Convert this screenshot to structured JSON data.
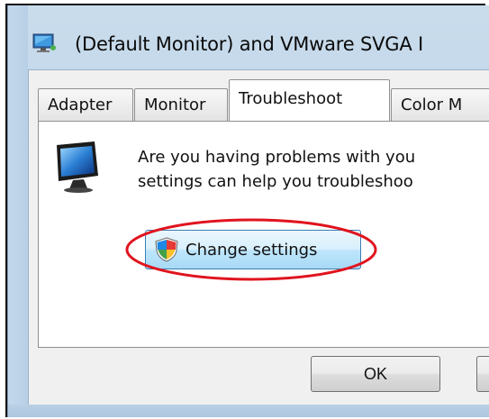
{
  "window": {
    "title": "(Default Monitor) and VMware SVGA I"
  },
  "tabs": [
    {
      "label": "Adapter",
      "active": false
    },
    {
      "label": "Monitor",
      "active": false
    },
    {
      "label": "Troubleshoot",
      "active": true
    },
    {
      "label": "Color M",
      "active": false
    }
  ],
  "troubleshoot": {
    "line1": "Are you having problems with you",
    "line2": "settings can help you troubleshoo",
    "change_settings_label": "Change settings"
  },
  "footer": {
    "ok_label": "OK"
  },
  "icons": {
    "title": "display-settings-icon",
    "monitor": "monitor-icon",
    "shield": "uac-shield-icon"
  },
  "colors": {
    "highlight": "#e0141e",
    "button_blue": "#bee6fd"
  }
}
